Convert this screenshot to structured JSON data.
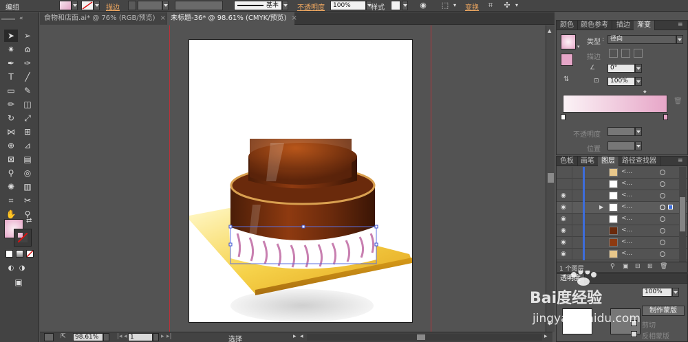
{
  "control_bar": {
    "selection_type": "编组",
    "stroke_label": "描边",
    "stroke_style": "基本",
    "opacity_label": "不透明度",
    "opacity_value": "100%",
    "style_label": "样式",
    "transform_label": "变换"
  },
  "tabs": [
    {
      "label": "食物和店面.ai* @ 76% (RGB/预览)",
      "close": "×"
    },
    {
      "label": "未标题-36* @ 98.61% (CMYK/预览)",
      "close": "×"
    }
  ],
  "status_bar": {
    "zoom": "98.61%",
    "artboard_num": "1",
    "tool_status": "选择"
  },
  "gradient_panel": {
    "tabs": [
      "颜色",
      "颜色参考",
      "描边",
      "渐变"
    ],
    "type_label": "类型",
    "type_value": "径向",
    "stroke_label": "描边",
    "angle_value": "0°",
    "aspect_value": "100%",
    "opacity_label": "不透明度",
    "location_label": "位置"
  },
  "layers_panel": {
    "tabs": [
      "色板",
      "画笔",
      "图层",
      "路径查找器"
    ],
    "footer": "1 个图层",
    "rows": [
      {
        "name": "<...",
        "thumb": "sauce"
      },
      {
        "name": "<...",
        "thumb": "white"
      },
      {
        "name": "<...",
        "thumb": "white"
      },
      {
        "name": "<...",
        "thumb": "white"
      },
      {
        "name": "<...",
        "thumb": "white"
      },
      {
        "name": "<...",
        "thumb": "brown"
      },
      {
        "name": "<...",
        "thumb": "brown"
      },
      {
        "name": "<...",
        "thumb": "cream"
      }
    ]
  },
  "transparency_panel": {
    "tab": "透明度",
    "opacity_value": "100%",
    "make_mask": "制作蒙版",
    "clip": "剪切",
    "invert_mask": "反相蒙版"
  },
  "watermark": {
    "logo": "Bai度经验",
    "url": "jingyan.baidu.com"
  },
  "colors": {
    "fill_gradient_start": "#f3d6e6",
    "fill_gradient_end": "#e7a8c8",
    "layer_color": "#3d6ddb",
    "guide": "#b8323a"
  }
}
